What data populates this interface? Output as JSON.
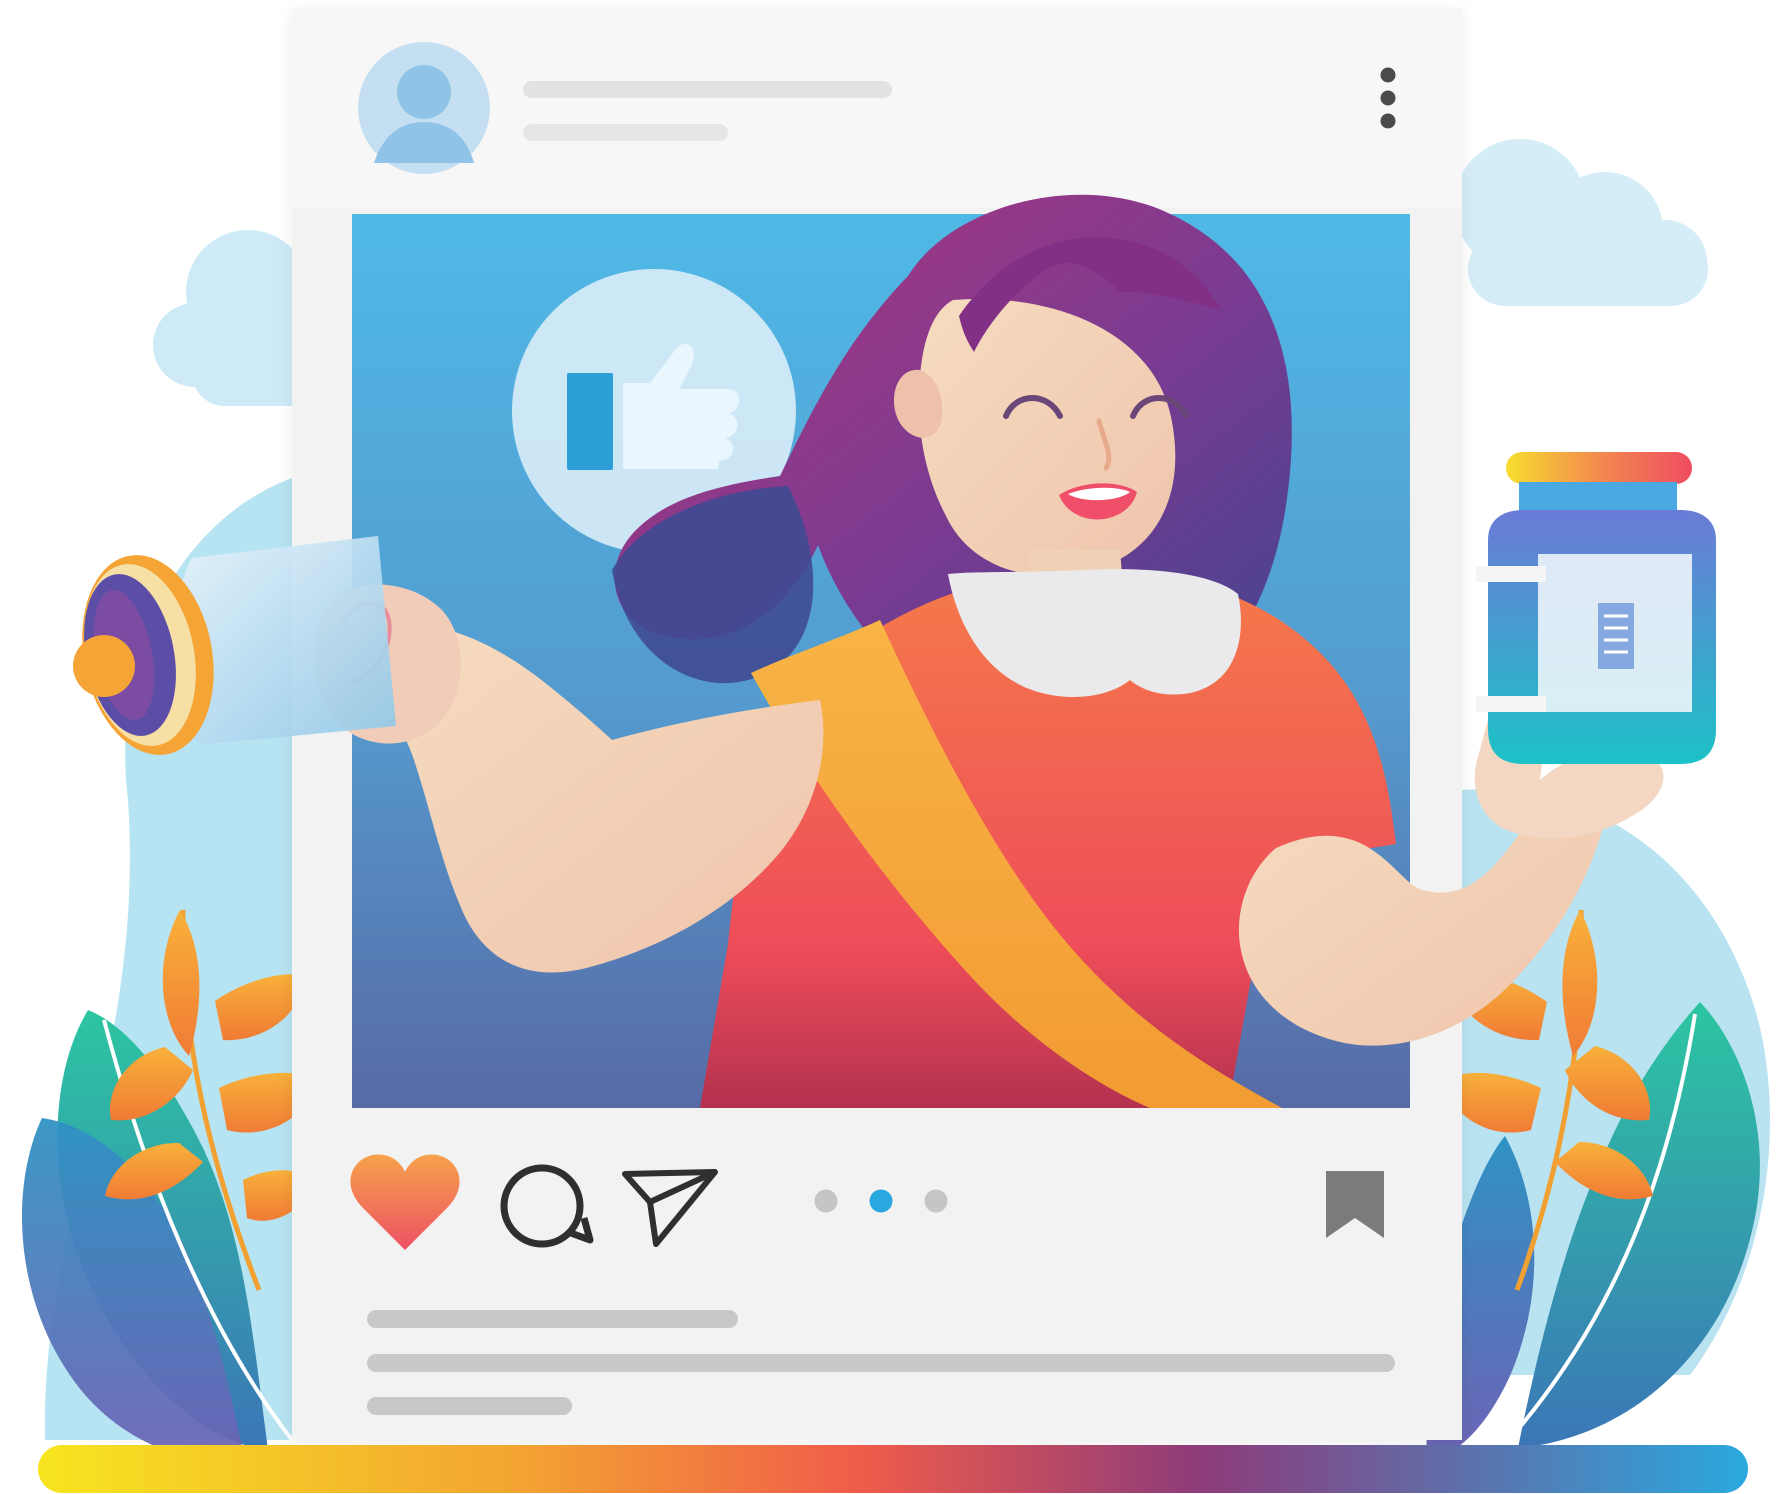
{
  "colors": {
    "background": "#ffffff",
    "sky_blob": "#a9def0",
    "cloud": "#cdeaf6",
    "card": "#f1f2f3",
    "post_image_top": "#2aa9e0",
    "post_image_bottom": "#334a93",
    "hair": "#7c3d93",
    "shirt": "#f05a4f",
    "sash": "#f6aa3c",
    "skin": "#f3d7bd",
    "heart": "#f1675c",
    "active_dot": "#29a8df",
    "inactive_dot": "#c5c6c8",
    "bookmark": "#7a7a7a",
    "bar_gradient": [
      "#f7e41d",
      "#f3a332",
      "#f05d4a",
      "#8a3b7b",
      "#2ba8df"
    ]
  },
  "post": {
    "avatar_icon": "user-avatar-icon",
    "menu_icon": "vertical-dots-icon",
    "active_slide": 2,
    "slide_count": 3,
    "actions": {
      "like_icon": "heart-icon",
      "comment_icon": "comment-bubble-icon",
      "share_icon": "paper-plane-icon",
      "save_icon": "bookmark-icon"
    }
  },
  "illustration": {
    "reaction_icon": "thumbs-up-icon",
    "megaphone_icon": "megaphone-icon",
    "product_icon": "product-jar-icon",
    "plants": "orange-and-teal-leaves"
  }
}
